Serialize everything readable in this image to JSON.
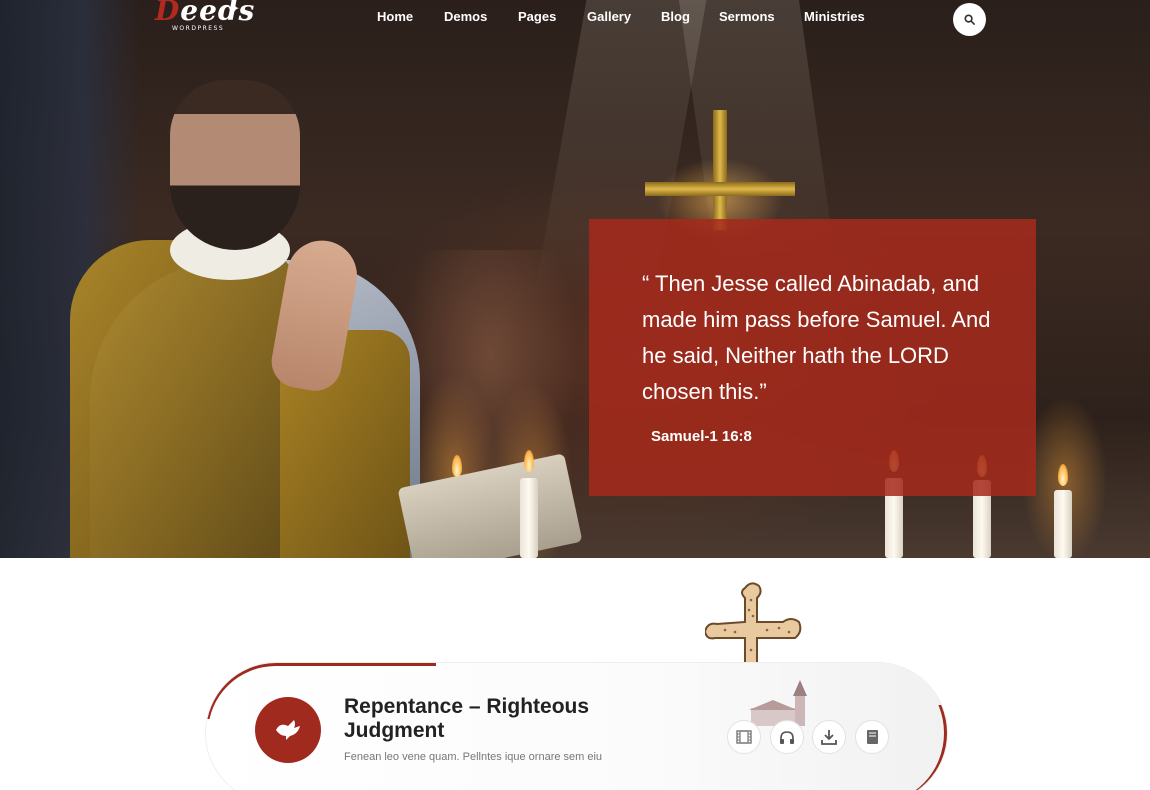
{
  "brand": {
    "logo_first": "D",
    "logo_rest": "eeds",
    "logo_sub": "WORDPRESS"
  },
  "nav": {
    "items": [
      {
        "label": "Home"
      },
      {
        "label": "Demos"
      },
      {
        "label": "Pages"
      },
      {
        "label": "Gallery"
      },
      {
        "label": "Blog"
      },
      {
        "label": "Sermons"
      },
      {
        "label": "Ministries"
      }
    ],
    "search_icon": "search-icon"
  },
  "hero": {
    "quote": "“ Then Jesse called Abinadab, and made him pass before Samuel. And he said, Neither hath the LORD chosen this.”",
    "reference": "Samuel-1 16:8"
  },
  "sermon": {
    "title": "Repentance – Righteous Judgment",
    "subtitle": "Fenean leo vene quam. Pellntes ique ornare sem eiu",
    "icon": "dove-icon",
    "actions": [
      {
        "name": "video-icon"
      },
      {
        "name": "headphones-icon"
      },
      {
        "name": "download-icon"
      },
      {
        "name": "book-icon"
      }
    ]
  },
  "colors": {
    "accent": "#a12a1f",
    "quote_bg": "#a52a1c",
    "text_dark": "#222222"
  }
}
